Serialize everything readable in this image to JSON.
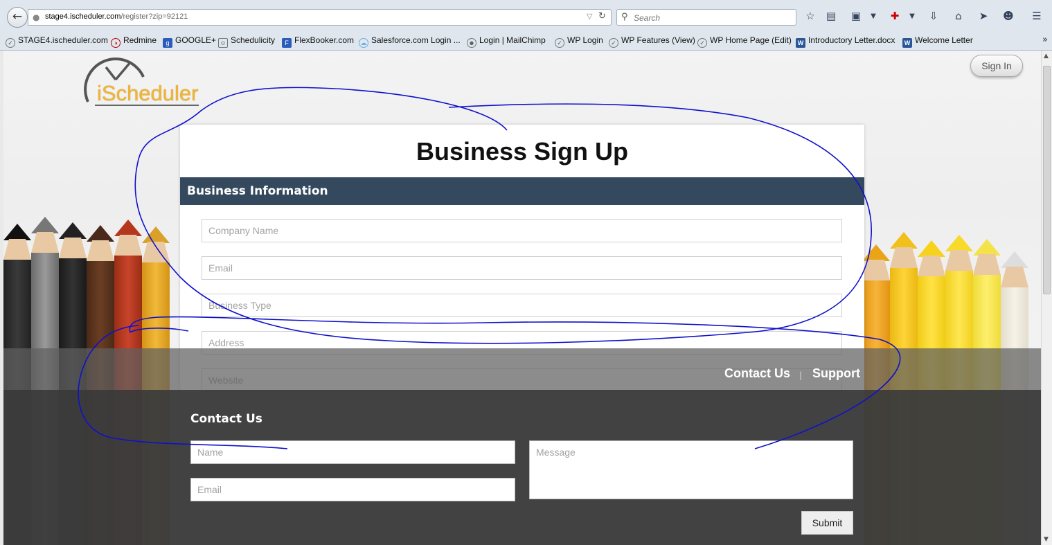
{
  "browser": {
    "url_host": "stage4.ischeduler.com",
    "url_path": "/register?zip=92121",
    "search_placeholder": "Search",
    "bookmarks": [
      "STAGE4.ischeduler.com",
      "Redmine",
      "GOOGLE+",
      "Schedulicity",
      "FlexBooker.com",
      "Salesforce.com Login ...",
      "Login | MailChimp",
      "WP Login",
      "WP Features (View)",
      "WP Home Page (Edit)",
      "Introductory Letter.docx",
      "Welcome Letter"
    ],
    "toolbar_icons": [
      "bookmark-star-icon",
      "reading-list-icon",
      "save-icon",
      "addon-icon",
      "download-icon",
      "home-icon",
      "send-icon",
      "emoji-icon",
      "menu-icon"
    ]
  },
  "header": {
    "logo_text": "iScheduler",
    "signin_label": "Sign In"
  },
  "form": {
    "title": "Business Sign Up",
    "section_title": "Business Information",
    "fields": {
      "company_name": "Company Name",
      "email": "Email",
      "business_type": "Business Type",
      "address": "Address",
      "website": "Website"
    }
  },
  "footer": {
    "link_contact": "Contact Us",
    "link_support": "Support",
    "separator": "|",
    "contact_title": "Contact Us",
    "name_placeholder": "Name",
    "email_placeholder": "Email",
    "message_placeholder": "Message",
    "submit_label": "Submit"
  },
  "colors": {
    "section_bar": "#34495e",
    "logo_accent": "#f3b434",
    "annotation_ink": "#1010cc"
  }
}
